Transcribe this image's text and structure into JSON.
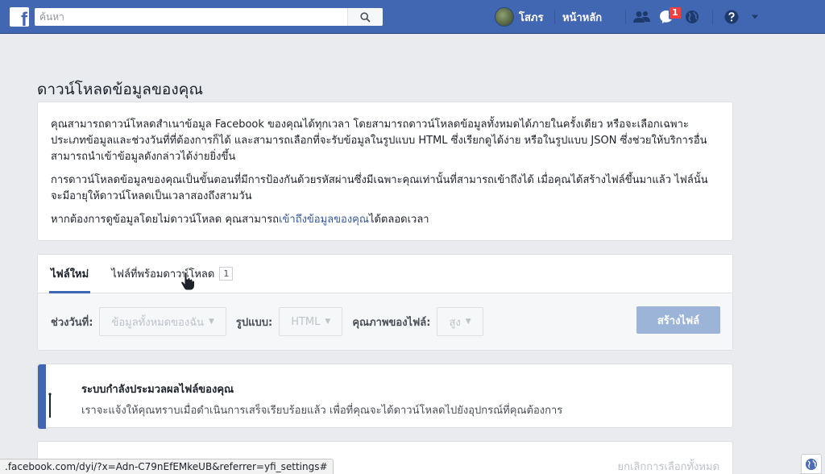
{
  "header": {
    "search_placeholder": "ค้นหา",
    "profile_name": "โสภร",
    "home_label": "หน้าหลัก",
    "notification_count": "1"
  },
  "main": {
    "title": "ดาวน์โหลดข้อมูลของคุณ",
    "intro": {
      "p1": "คุณสามารถดาวน์โหลดสำเนาข้อมูล Facebook ของคุณได้ทุกเวลา โดยสามารถดาวน์โหลดข้อมูลทั้งหมดได้ภายในครั้งเดียว หรือจะเลือกเฉพาะประเภทข้อมูลและช่วงวันที่ที่ต้องการก็ได้ และสามารถเลือกที่จะรับข้อมูลในรูปแบบ HTML ซึ่งเรียกดูได้ง่าย หรือในรูปแบบ JSON ซึ่งช่วยให้บริการอื่นสามารถนำเข้าข้อมูลดังกล่าวได้ง่ายยิ่งขึ้น",
      "p2": "การดาวน์โหลดข้อมูลของคุณเป็นขั้นตอนที่มีการป้องกันด้วยรหัสผ่านซึ่งมีเฉพาะคุณเท่านั้นที่สามารถเข้าถึงได้ เมื่อคุณได้สร้างไฟล์ขึ้นมาแล้ว ไฟล์นั้นจะมีอายุให้ดาวน์โหลดเป็นเวลาสองถึงสามวัน",
      "p3_before": "หากต้องการดูข้อมูลโดยไม่ดาวน์โหลด คุณสามารถ",
      "p3_link": "เข้าถึงข้อมูลของคุณ",
      "p3_after": "ได้ตลอดเวลา"
    },
    "tabs": [
      {
        "label": "ไฟล์ใหม่"
      },
      {
        "label": "ไฟล์ที่พร้อมดาวน์โหลด",
        "count": "1"
      }
    ],
    "filters": {
      "date_label": "ช่วงวันที่:",
      "date_value": "ข้อมูลทั้งหมดของฉัน",
      "format_label": "รูปแบบ:",
      "format_value": "HTML",
      "quality_label": "คุณภาพของไฟล์:",
      "quality_value": "สูง",
      "create_label": "สร้างไฟล์"
    },
    "notice": {
      "title": "ระบบกำลังประมวลผลไฟล์ของคุณ",
      "text": "เราจะแจ้งให้คุณทราบเมื่อดำเนินการเสร็จเรียบร้อยแล้ว เพื่อที่คุณจะได้ดาวน์โหลดไปยังอุปกรณ์ที่คุณต้องการ"
    },
    "deselect_all": "ยกเลิกการเลือกทั้งหมด"
  },
  "statusbar": {
    "url": ".facebook.com/dyi/?x=Adn-C79nEfEMkeUB&referrer=yfi_settings#"
  },
  "colors": {
    "brand": "#4267b2",
    "button_disabled": "#9cb4d8",
    "badge": "#fa3e3e"
  }
}
